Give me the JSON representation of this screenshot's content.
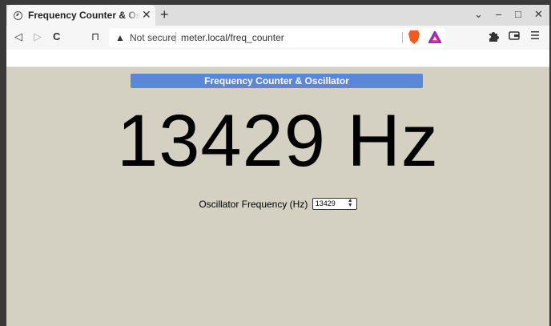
{
  "browser": {
    "tab": {
      "title": "Frequency Counter & Oscillator",
      "close": "✕"
    },
    "new_tab": "+",
    "window_controls": {
      "dropdown": "⌄",
      "minimize": "–",
      "maximize": "□",
      "close": "✕"
    },
    "nav": {
      "back": "◁",
      "forward": "▷",
      "reload": "C",
      "bookmark": "⊓"
    },
    "omnibox": {
      "security": "Not secure",
      "url": "meter.local/freq_counter"
    },
    "toolbar_icons": [
      "extensions-icon",
      "wallet-icon",
      "menu-icon"
    ]
  },
  "page": {
    "banner": "Frequency Counter & Oscillator",
    "frequency_display": "13429 Hz",
    "oscillator": {
      "label": "Oscillator Frequency (Hz)",
      "value": "13429"
    }
  }
}
